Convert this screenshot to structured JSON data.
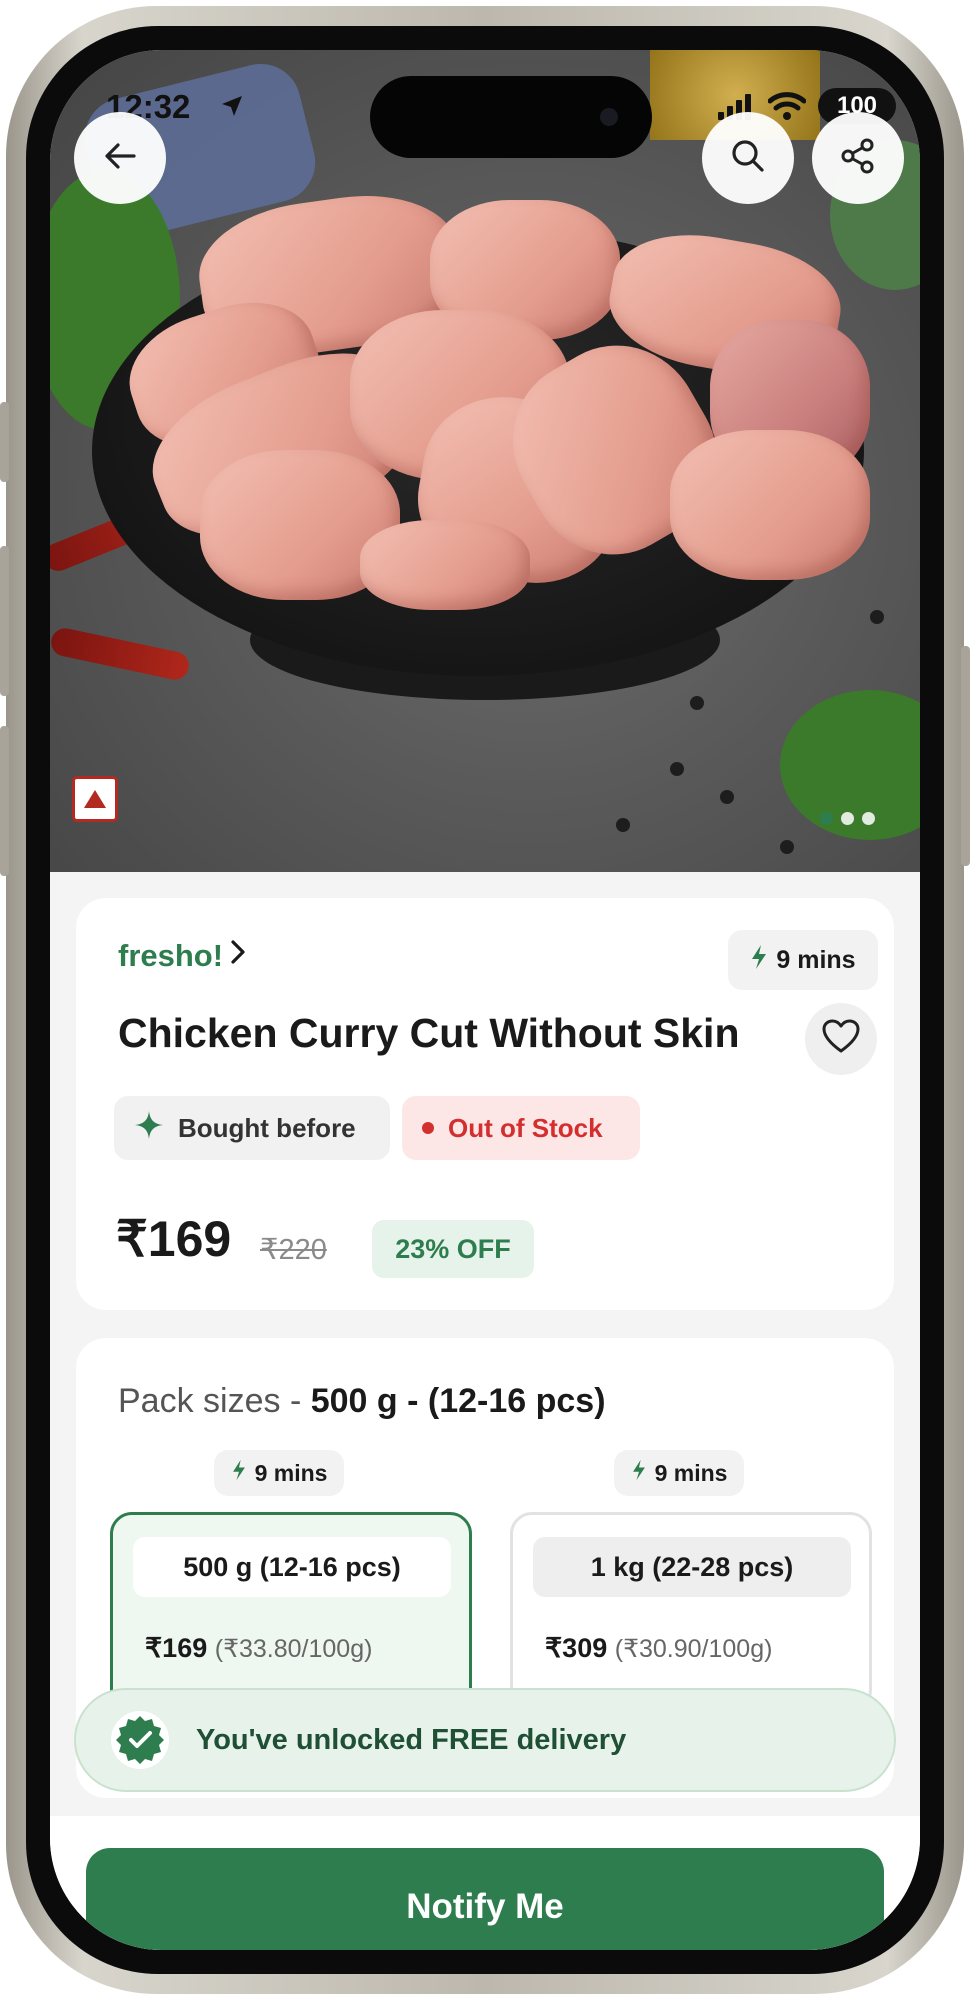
{
  "status_bar": {
    "time": "12:32",
    "battery": "100"
  },
  "product": {
    "brand": "fresho!",
    "delivery_eta": "9 mins",
    "title": "Chicken Curry Cut Without Skin",
    "tags": {
      "bought_before": "Bought before",
      "stock_status": "Out of Stock"
    },
    "price": "₹169",
    "mrp": "₹220",
    "discount": "23% OFF"
  },
  "pack_sizes": {
    "label": "Pack sizes - ",
    "selected": "500 g - (12-16 pcs)",
    "options": [
      {
        "eta": "9 mins",
        "label": "500 g (12-16 pcs)",
        "price": "₹169",
        "unit_price": "(₹33.80/100g)",
        "selected": true
      },
      {
        "eta": "9 mins",
        "label": "1 kg (22-28 pcs)",
        "price": "₹309",
        "unit_price": "(₹30.90/100g)",
        "selected": false
      }
    ]
  },
  "free_delivery_banner": "You've unlocked FREE delivery",
  "cta": {
    "notify_label": "Notify Me"
  },
  "carousel": {
    "pages": 3,
    "active": 1
  },
  "colors": {
    "accent": "#2e7d4f",
    "out_of_stock": "#d32f2f",
    "banner_bg": "#e7f3ea"
  },
  "icons": [
    "back-arrow-icon",
    "search-icon",
    "share-icon",
    "location-arrow-icon",
    "veg-nonveg-icon",
    "lightning-icon",
    "heart-icon",
    "sparkle-icon",
    "check-badge-icon"
  ]
}
